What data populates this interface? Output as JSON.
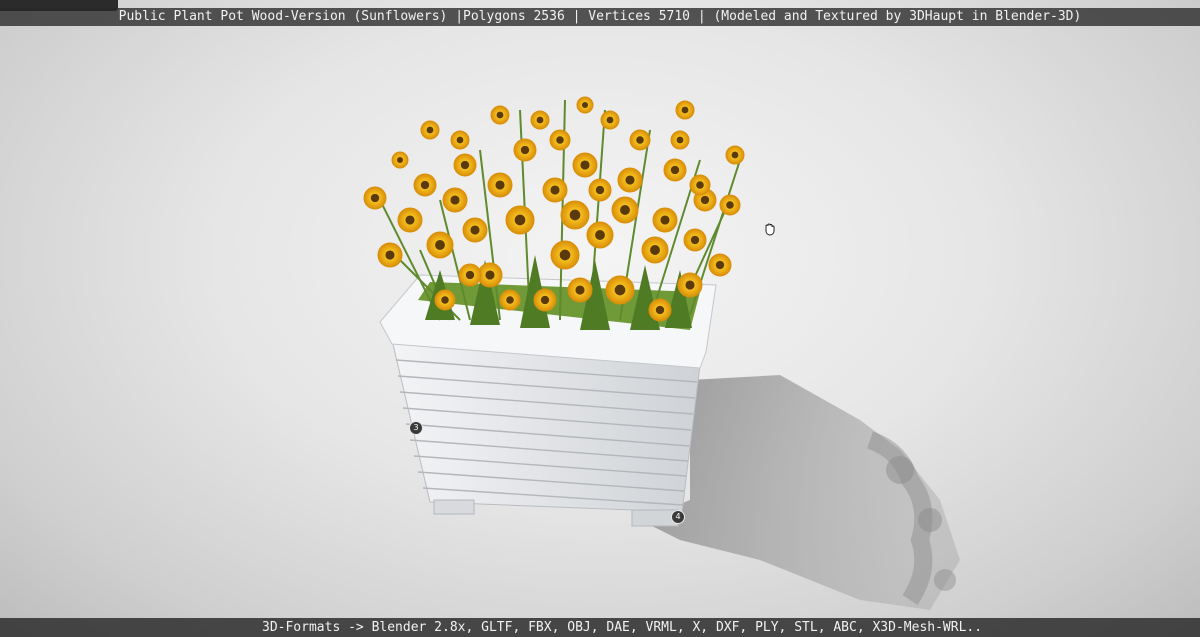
{
  "viewer": {
    "title": "Public Plant Pot Wood-Version (Sunflowers) |Polygons 2536 | Vertices 5710 | (Modeled and Textured by 3DHaupt in Blender-3D)",
    "formats": "3D-Formats -> Blender 2.8x, GLTF, FBX, OBJ, DAE, VRML, X, DXF, PLY, STL, ABC, X3D-Mesh-WRL..",
    "hotspots": [
      {
        "label": "3"
      },
      {
        "label": "4"
      }
    ]
  },
  "colors": {
    "petal": "#f2b417",
    "petal_dark": "#d98f0a",
    "center": "#5a3a0c",
    "leaf": "#5f8a2e",
    "pot": "#eef0f2"
  },
  "icons": {
    "cursor": "grab-hand-icon"
  }
}
